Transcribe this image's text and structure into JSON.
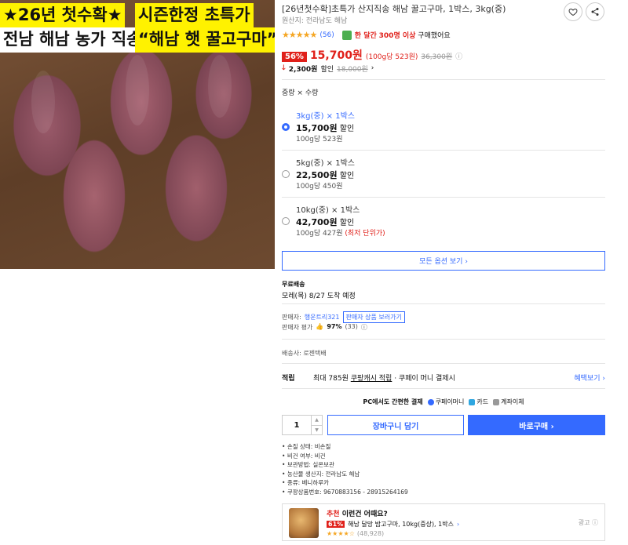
{
  "hero": {
    "banner1": "★26년 첫수확★",
    "banner2": "시즌한정 초특가",
    "banner3": "전남 해남 농가 직송",
    "banner4": "“해남 햇 꿀고구마”"
  },
  "product": {
    "title": "[26년첫수확]초특가 산지직송 해남 꿀고구마, 1박스, 3kg(중)",
    "origin": "원산지: 전라남도 해남",
    "stars": "★★★★★",
    "rating_fraction": 0.9,
    "review_count": "(56)",
    "bought_prefix": "한 달간",
    "bought_count": "300명 이상",
    "bought_suffix": "구매했어요"
  },
  "price": {
    "discount": "56%",
    "sale": "15,700원",
    "unit": "(100g당 523원)",
    "original": "36,300원",
    "info_icon": "ⓘ",
    "save_arrow": "🡓",
    "save_amount": "2,300원",
    "save_label": "할인",
    "save_original": "18,000원",
    "save_chev": "›"
  },
  "options": {
    "label": "중량 × 수량",
    "items": [
      {
        "name": "3kg(중) × 1박스",
        "price": "15,700원",
        "price_suffix": "할인",
        "unit": "100g당 523원",
        "extra": ""
      },
      {
        "name": "5kg(중) × 1박스",
        "price": "22,500원",
        "price_suffix": "할인",
        "unit": "100g당 450원",
        "extra": ""
      },
      {
        "name": "10kg(중) × 1박스",
        "price": "42,700원",
        "price_suffix": "할인",
        "unit": "100g당 427원",
        "extra": "(최저 단위가)"
      }
    ],
    "all_button": "모든 옵션 보기 ›"
  },
  "shipping": {
    "type": "무료배송",
    "eta": "모레(목) 8/27 도착 예정"
  },
  "seller": {
    "label": "판매자:",
    "name": "행운트리321",
    "link": "판매자 상품 보러가기",
    "eval_label": "판매자 평가",
    "eval_icon": "👍",
    "eval_score": "97%",
    "eval_count": "(33)",
    "eval_info": "ⓘ"
  },
  "courier": "배송사: 로젠택배",
  "reward": {
    "label": "적립",
    "prefix": "최대 785원",
    "cash": "쿠팡캐시 적립",
    "suffix": "· 쿠페이 머니 결제시",
    "benefit": "혜택보기 ›"
  },
  "pay": {
    "main": "PC에서도 간편한 결제",
    "m1": "쿠페이머니",
    "m2": "카드",
    "m3": "계좌이체"
  },
  "qty": {
    "value": "1",
    "up": "▲",
    "down": "▼"
  },
  "buttons": {
    "cart": "장바구니 담기",
    "buy": "바로구매 ›"
  },
  "specs": [
    "손질 상태: 비손질",
    "비건 여부: 비건",
    "보관방법: 실온보관",
    "농산물 생산지: 전라남도 해남",
    "종류: 베니하루카",
    "쿠팡상품번호: 9670883156 - 28915264169"
  ],
  "rec": {
    "hot": "추천",
    "head": "이런건 어때요?",
    "disc": "61%",
    "name": "해남 달망 밤고구마, 10kg(중상), 1박스",
    "chev": "›",
    "stars": "★★★★☆",
    "count": "(48,928)",
    "ad": "광고 ⓘ"
  },
  "colors": {
    "accent": "#346aff",
    "sale": "#e0201a",
    "star": "#f5a623",
    "banner": "#fff200"
  }
}
